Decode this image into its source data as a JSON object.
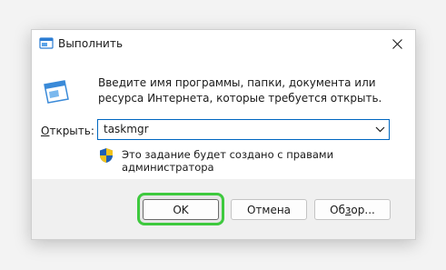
{
  "window": {
    "title": "Выполнить",
    "close_glyph": "✕"
  },
  "content": {
    "description": "Введите имя программы, папки, документа или ресурса Интернета, которые требуется открыть.",
    "open_label_accel": "О",
    "open_label_rest": "ткрыть:",
    "input_value": "taskmgr",
    "admin_note": "Это задание будет создано с правами администратора"
  },
  "buttons": {
    "ok_label": "OK",
    "cancel_label": "Отмена",
    "browse_label_pre": "Об",
    "browse_label_accel": "з",
    "browse_label_post": "ор..."
  },
  "icons": {
    "title": "run-icon",
    "main": "run-icon",
    "close": "close-icon",
    "dropdown": "chevron-down-icon",
    "shield": "uac-shield-icon"
  },
  "colors": {
    "accent": "#0067c0",
    "highlight": "#3ec93e",
    "footer_bg": "#f0f0f0"
  }
}
